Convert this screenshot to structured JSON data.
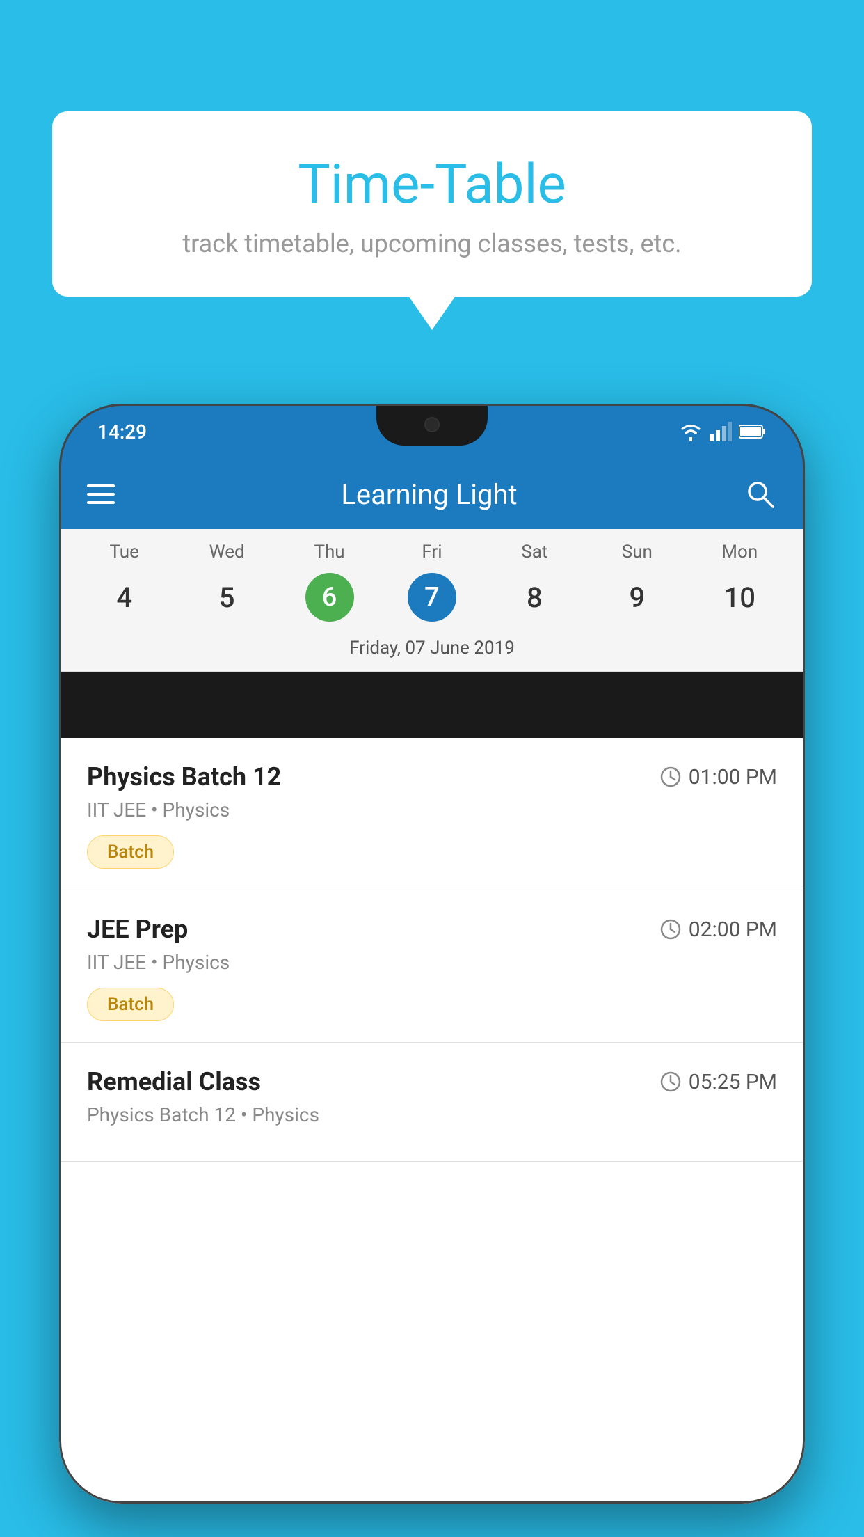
{
  "background": {
    "color": "#29bde8"
  },
  "speech_bubble": {
    "title": "Time-Table",
    "subtitle": "track timetable, upcoming classes, tests, etc."
  },
  "phone": {
    "status_bar": {
      "time": "14:29"
    },
    "app_bar": {
      "title": "Learning Light"
    },
    "calendar": {
      "days": [
        {
          "short": "Tue",
          "num": "4"
        },
        {
          "short": "Wed",
          "num": "5"
        },
        {
          "short": "Thu",
          "num": "6",
          "state": "today"
        },
        {
          "short": "Fri",
          "num": "7",
          "state": "selected"
        },
        {
          "short": "Sat",
          "num": "8"
        },
        {
          "short": "Sun",
          "num": "9"
        },
        {
          "short": "Mon",
          "num": "10"
        }
      ],
      "date_label": "Friday, 07 June 2019"
    },
    "schedule": [
      {
        "title": "Physics Batch 12",
        "time": "01:00 PM",
        "subtitle": "IIT JEE • Physics",
        "badge": "Batch"
      },
      {
        "title": "JEE Prep",
        "time": "02:00 PM",
        "subtitle": "IIT JEE • Physics",
        "badge": "Batch"
      },
      {
        "title": "Remedial Class",
        "time": "05:25 PM",
        "subtitle": "Physics Batch 12 • Physics",
        "badge": null
      }
    ]
  }
}
